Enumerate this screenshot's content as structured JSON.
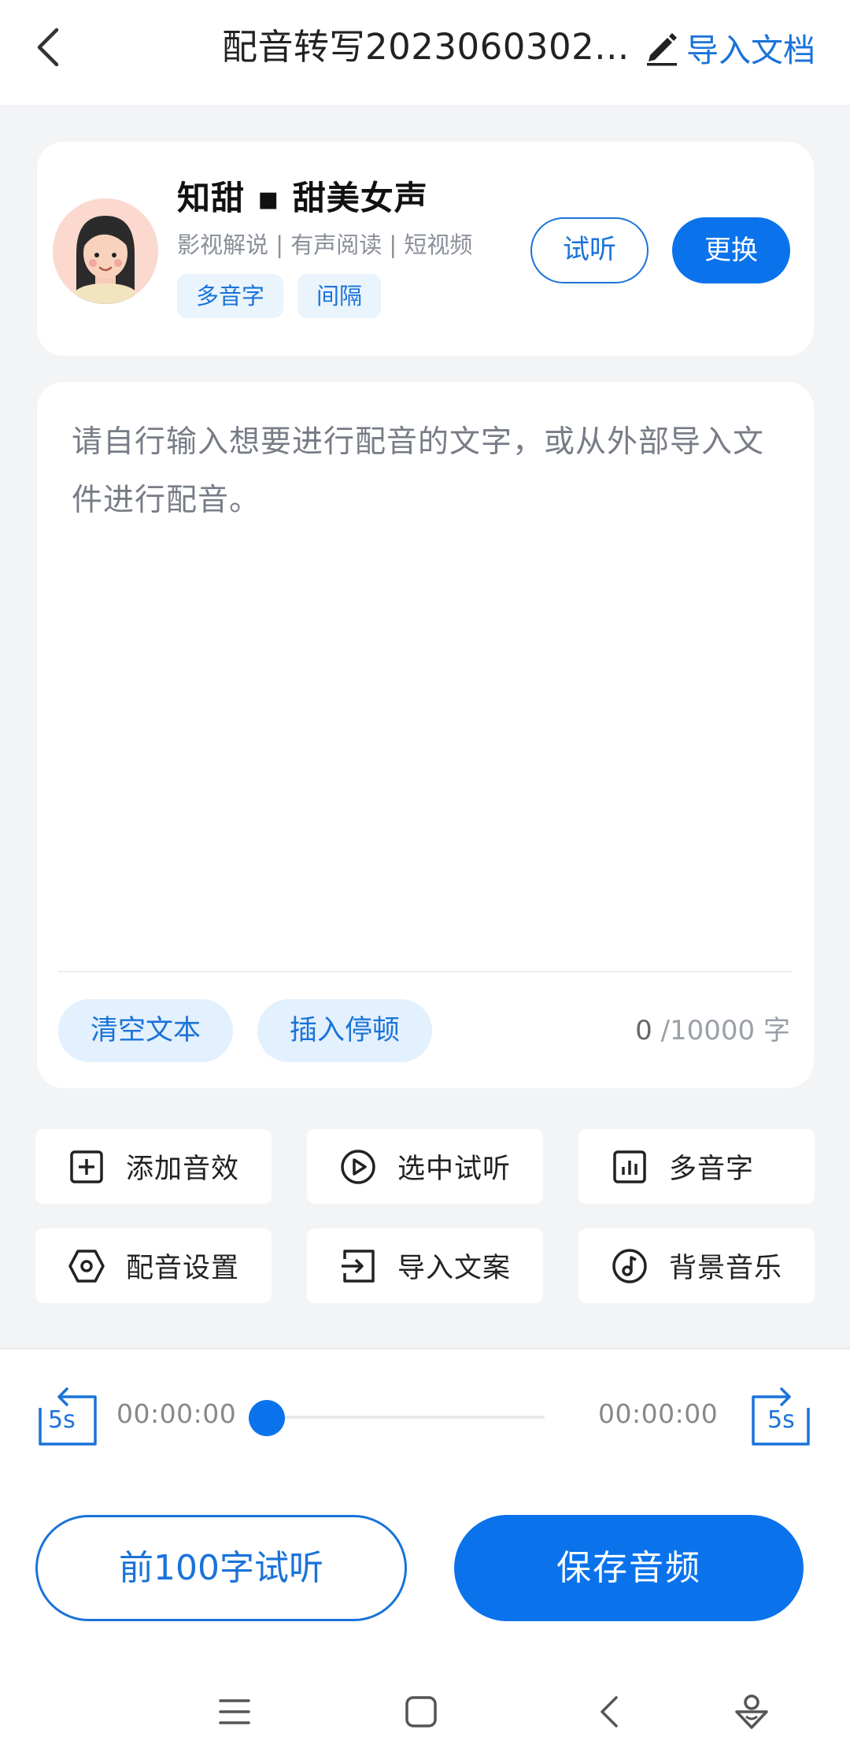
{
  "header": {
    "title": "配音转写2023060302...",
    "import_doc_label": "导入文档"
  },
  "voice": {
    "name": "知甜 ▪ 甜美女声",
    "tags": "影视解说 | 有声阅读 | 短视频",
    "chips": [
      "多音字",
      "间隔"
    ],
    "audition_label": "试听",
    "change_label": "更换"
  },
  "editor": {
    "placeholder": "请自行输入想要进行配音的文字，或从外部导入文件进行配音。",
    "clear_label": "清空文本",
    "insert_pause_label": "插入停顿",
    "count_current": "0",
    "count_max": " /10000 字"
  },
  "tools": [
    {
      "label": "添加音效",
      "icon": "plus-square-icon"
    },
    {
      "label": "选中试听",
      "icon": "play-circle-icon"
    },
    {
      "label": "多音字",
      "icon": "bar-chart-icon"
    },
    {
      "label": "配音设置",
      "icon": "hexagon-settings-icon"
    },
    {
      "label": "导入文案",
      "icon": "import-icon"
    },
    {
      "label": "背景音乐",
      "icon": "music-note-icon"
    }
  ],
  "player": {
    "rewind_label": "5s",
    "forward_label": "5s",
    "current_time": "00:00:00",
    "total_time": "00:00:00",
    "progress": 0
  },
  "actions": {
    "preview_label": "前100字试听",
    "save_label": "保存音频"
  },
  "colors": {
    "accent": "#0a73ec",
    "accent_text": "#1a73d9",
    "chip_bg": "#eaf4fd",
    "page_bg": "#f3f4f6"
  }
}
